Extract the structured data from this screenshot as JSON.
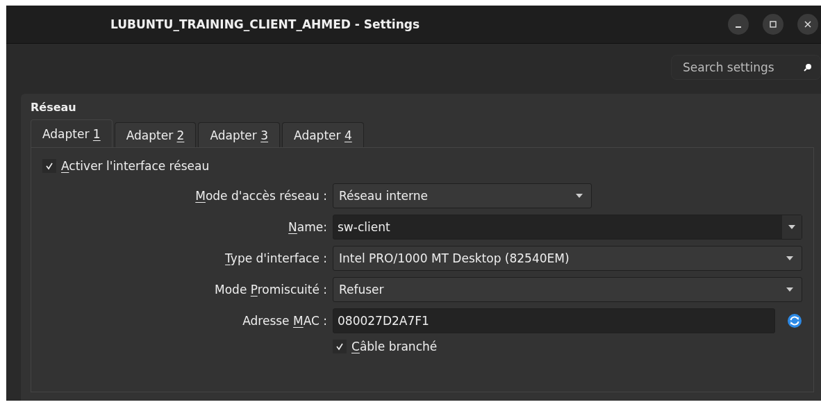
{
  "window": {
    "title": "LUBUNTU_TRAINING_CLIENT_AHMED - Settings",
    "controls": [
      {
        "kind": "minimize"
      },
      {
        "kind": "maximize"
      },
      {
        "kind": "close"
      }
    ]
  },
  "search": {
    "placeholder": "Search settings"
  },
  "group": {
    "title": "Réseau"
  },
  "tabs": [
    {
      "label_parts": [
        {
          "text": "Adapter "
        },
        {
          "text": "1",
          "underlined": true
        }
      ],
      "selected": true
    },
    {
      "label_parts": [
        {
          "text": "Adapter "
        },
        {
          "text": "2",
          "underlined": true
        }
      ],
      "selected": false
    },
    {
      "label_parts": [
        {
          "text": "Adapter "
        },
        {
          "text": "3",
          "underlined": true
        }
      ],
      "selected": false
    },
    {
      "label_parts": [
        {
          "text": "Adapter "
        },
        {
          "text": "4",
          "underlined": true
        }
      ],
      "selected": false
    }
  ],
  "enable_checkbox": {
    "checked": true,
    "label_parts": [
      {
        "text": "A",
        "underlined": true
      },
      {
        "text": "ctiver l'interface réseau"
      }
    ]
  },
  "fields": [
    {
      "kind": "dropdown",
      "label_parts": [
        {
          "text": "M",
          "underlined": true
        },
        {
          "text": "ode d'accès réseau :"
        }
      ],
      "value": "Réseau interne"
    },
    {
      "kind": "combo",
      "label_parts": [
        {
          "text": "N",
          "underlined": true
        },
        {
          "text": "ame:"
        }
      ],
      "value": "sw-client"
    },
    {
      "kind": "dropdown",
      "label_parts": [
        {
          "text": "T",
          "underlined": true
        },
        {
          "text": "ype d'interface :"
        }
      ],
      "value": "Intel PRO/1000 MT Desktop (82540EM)"
    },
    {
      "kind": "dropdown",
      "label_parts": [
        {
          "text": "Mode "
        },
        {
          "text": "P",
          "underlined": true
        },
        {
          "text": "romiscuité :"
        }
      ],
      "value": "Refuser"
    },
    {
      "kind": "text",
      "label_parts": [
        {
          "text": "Adresse "
        },
        {
          "text": "M",
          "underlined": true
        },
        {
          "text": "AC :"
        }
      ],
      "value": "080027D2A7F1"
    }
  ],
  "cable_checkbox": {
    "checked": true,
    "label_parts": [
      {
        "text": "C",
        "underlined": true
      },
      {
        "text": "âble branché"
      }
    ]
  }
}
